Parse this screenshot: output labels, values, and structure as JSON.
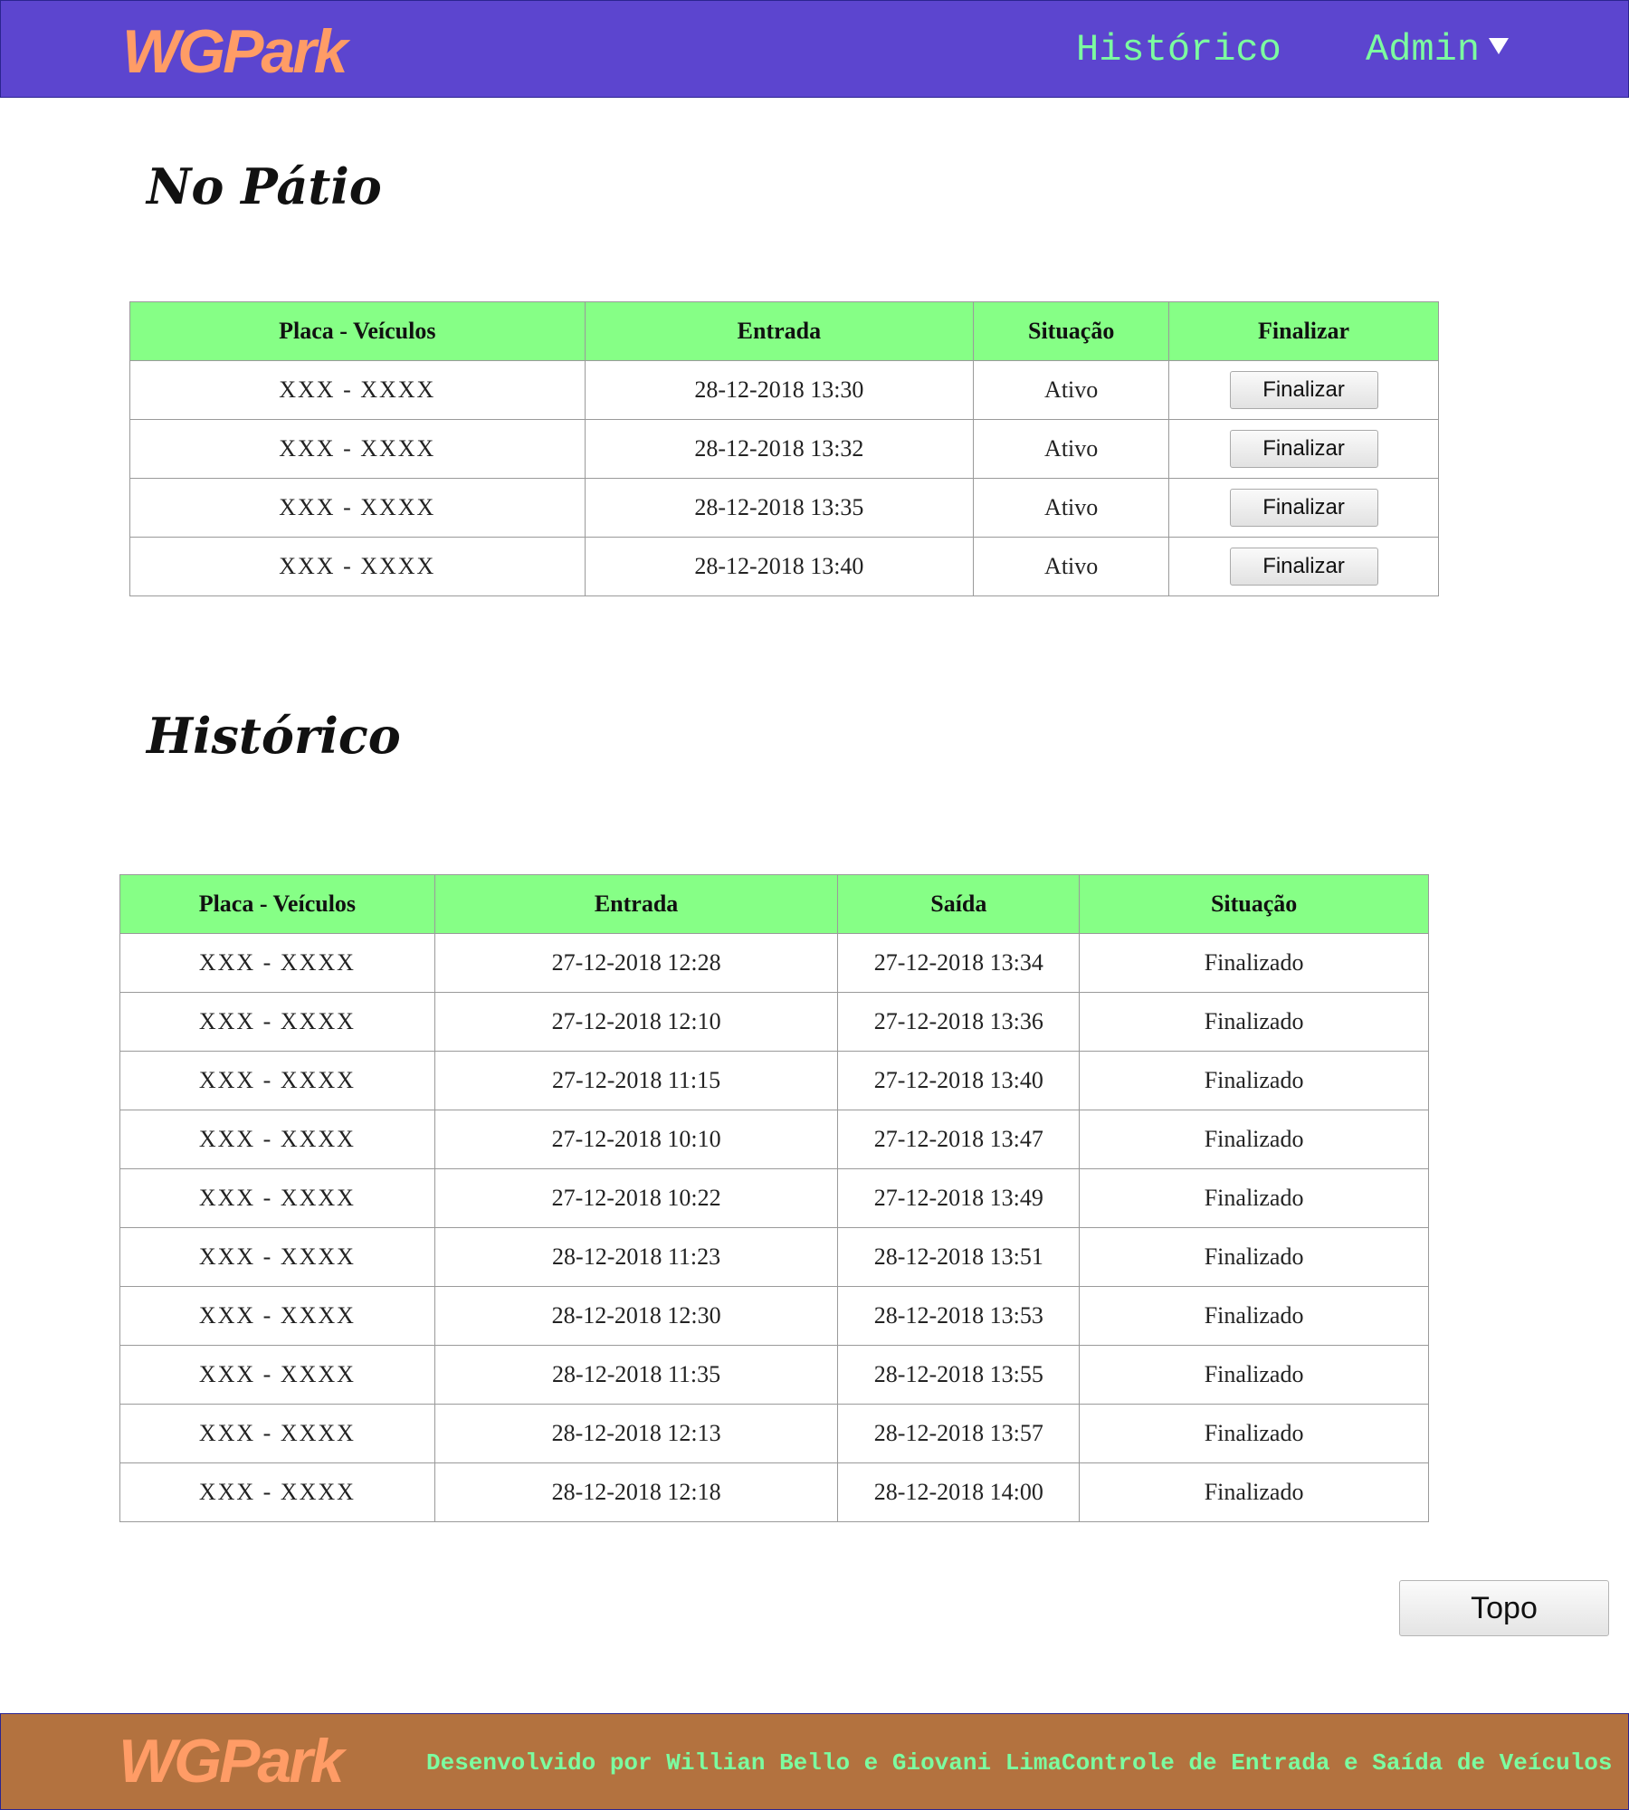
{
  "navbar": {
    "brand": "WGPark",
    "links": {
      "historico": "Histórico",
      "admin": "Admin"
    }
  },
  "patio": {
    "title": "No Pátio",
    "headers": [
      "Placa - Veículos",
      "Entrada",
      "Situação",
      "Finalizar"
    ],
    "rows": [
      {
        "placa": "XXX - XXXX",
        "entrada": "28-12-2018 13:30",
        "situacao": "Ativo",
        "action": "Finalizar"
      },
      {
        "placa": "XXX - XXXX",
        "entrada": "28-12-2018 13:32",
        "situacao": "Ativo",
        "action": "Finalizar"
      },
      {
        "placa": "XXX - XXXX",
        "entrada": "28-12-2018 13:35",
        "situacao": "Ativo",
        "action": "Finalizar"
      },
      {
        "placa": "XXX - XXXX",
        "entrada": "28-12-2018 13:40",
        "situacao": "Ativo",
        "action": "Finalizar"
      }
    ]
  },
  "historico": {
    "title": "Histórico",
    "headers": [
      "Placa - Veículos",
      "Entrada",
      "Saída",
      "Situação"
    ],
    "rows": [
      {
        "placa": "XXX - XXXX",
        "entrada": "27-12-2018 12:28",
        "saida": "27-12-2018 13:34",
        "situacao": "Finalizado"
      },
      {
        "placa": "XXX - XXXX",
        "entrada": "27-12-2018 12:10",
        "saida": "27-12-2018 13:36",
        "situacao": "Finalizado"
      },
      {
        "placa": "XXX - XXXX",
        "entrada": "27-12-2018 11:15",
        "saida": "27-12-2018 13:40",
        "situacao": "Finalizado"
      },
      {
        "placa": "XXX - XXXX",
        "entrada": "27-12-2018 10:10",
        "saida": "27-12-2018 13:47",
        "situacao": "Finalizado"
      },
      {
        "placa": "XXX - XXXX",
        "entrada": "27-12-2018 10:22",
        "saida": "27-12-2018 13:49",
        "situacao": "Finalizado"
      },
      {
        "placa": "XXX - XXXX",
        "entrada": "28-12-2018 11:23",
        "saida": "28-12-2018 13:51",
        "situacao": "Finalizado"
      },
      {
        "placa": "XXX - XXXX",
        "entrada": "28-12-2018 12:30",
        "saida": "28-12-2018 13:53",
        "situacao": "Finalizado"
      },
      {
        "placa": "XXX - XXXX",
        "entrada": "28-12-2018 11:35",
        "saida": "28-12-2018 13:55",
        "situacao": "Finalizado"
      },
      {
        "placa": "XXX - XXXX",
        "entrada": "28-12-2018 12:13",
        "saida": "28-12-2018 13:57",
        "situacao": "Finalizado"
      },
      {
        "placa": "XXX - XXXX",
        "entrada": "28-12-2018 12:18",
        "saida": "28-12-2018 14:00",
        "situacao": "Finalizado"
      }
    ]
  },
  "topo_button": "Topo",
  "footer": {
    "brand": "WGPark",
    "developed_by": "Desenvolvido por Willian Bello e Giovani Lima",
    "tagline": "Controle de Entrada e Saída de Veículos"
  },
  "colors": {
    "navbar_bg": "#5c45cf",
    "brand": "#ff9c66",
    "nav_link": "#7cfca0",
    "table_header_bg": "#86ff86",
    "footer_bg": "#b3723f"
  },
  "icons": {
    "admin_dropdown": "caret-down-icon"
  }
}
